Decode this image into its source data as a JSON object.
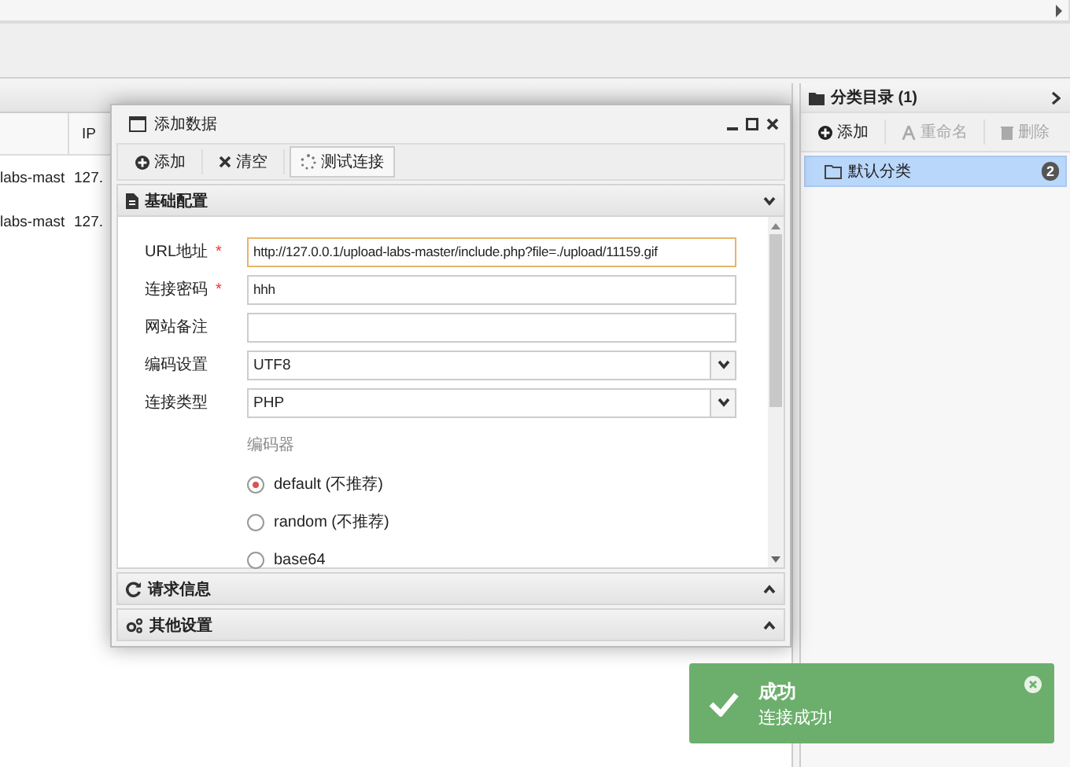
{
  "table": {
    "columns": [
      {},
      {
        "label": "IP"
      }
    ],
    "rows": [
      [
        "labs-mast",
        "127."
      ],
      [
        "labs-mast",
        "127."
      ]
    ]
  },
  "category_panel": {
    "title": "分类目录 (1)",
    "toolbar": [
      {
        "label": "添加",
        "disabled": false
      },
      {
        "label": "重命名",
        "disabled": true
      },
      {
        "label": "删除",
        "disabled": true
      }
    ],
    "items": [
      {
        "label": "默认分类",
        "count": "2",
        "selected": true
      }
    ]
  },
  "dialog": {
    "title": "添加数据",
    "toolbar": [
      {
        "label": "添加"
      },
      {
        "label": "清空"
      },
      {
        "label": "测试连接"
      }
    ],
    "sections": [
      {
        "title": "基础配置",
        "expanded": true
      },
      {
        "title": "请求信息",
        "expanded": false
      },
      {
        "title": "其他设置",
        "expanded": false
      }
    ],
    "fields": [
      {
        "kind": "text",
        "label": "URL地址",
        "marker": "*",
        "value": "http://127.0.0.1/upload-labs-master/include.php?file=./upload/11159.gif",
        "focused": true
      },
      {
        "kind": "text",
        "label": "连接密码",
        "marker": "*",
        "value": "hhh",
        "focused": false
      },
      {
        "kind": "text",
        "label": "网站备注",
        "focused": false
      },
      {
        "kind": "select",
        "label": "编码设置",
        "value": "UTF8",
        "focused": false
      },
      {
        "kind": "select",
        "label": "连接类型",
        "value": "PHP",
        "focused": false
      }
    ],
    "encoder": {
      "label": "编码器",
      "options": [
        {
          "label": "default (不推荐)",
          "selected": true
        },
        {
          "label": "random (不推荐)",
          "selected": false
        },
        {
          "label": "base64",
          "selected": false
        }
      ]
    }
  },
  "toast": {
    "title": "成功",
    "message": "连接成功!"
  }
}
